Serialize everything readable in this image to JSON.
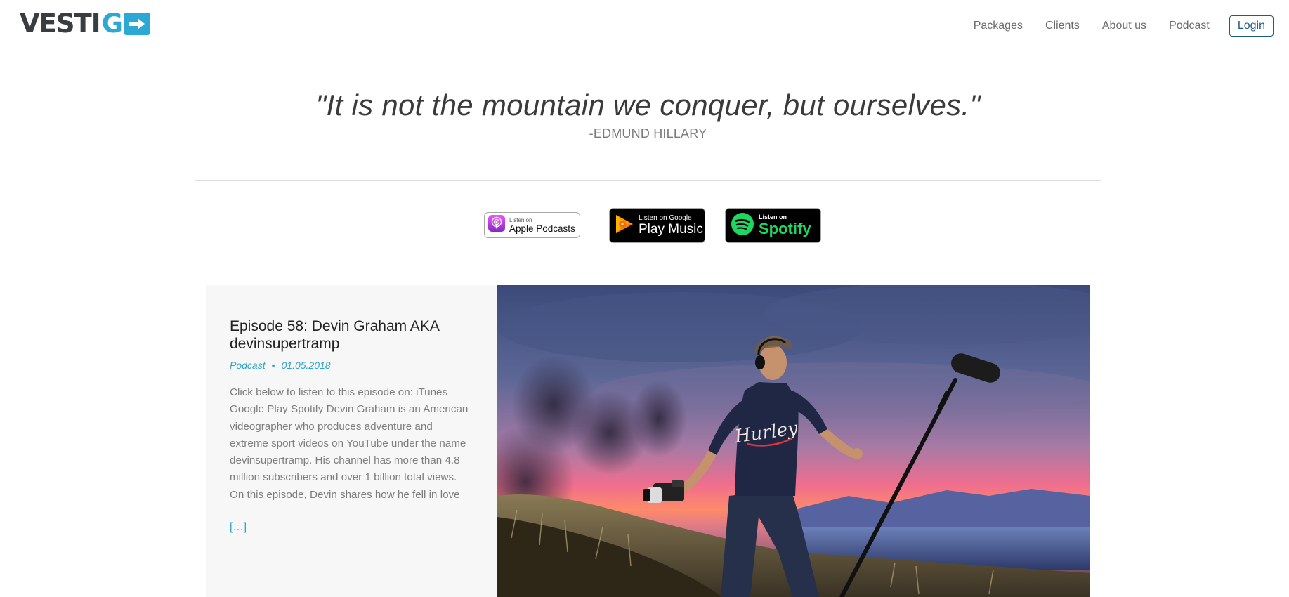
{
  "brand": {
    "logo_left": "VESTI",
    "logo_right": "G",
    "accent": "#2ba9d4",
    "logo_icon": "arrow-right-icon"
  },
  "nav": {
    "items": [
      {
        "label": "Packages"
      },
      {
        "label": "Clients"
      },
      {
        "label": "About us"
      },
      {
        "label": "Podcast"
      }
    ],
    "login_label": "Login"
  },
  "quote": {
    "text": "\"It is not the mountain we conquer, but ourselves.\"",
    "author": "-EDMUND HILLARY"
  },
  "badges": {
    "apple": {
      "small": "Listen on",
      "big": "Apple Podcasts",
      "icon": "podcast-icon"
    },
    "google": {
      "small": "Listen on Google",
      "big": "Play Music",
      "icon": "play-music-icon"
    },
    "spotify": {
      "small": "Listen on",
      "big": "Spotify",
      "icon": "spotify-icon"
    }
  },
  "episode": {
    "title": "Episode 58: Devin Graham AKA devinsupertramp",
    "category": "Podcast",
    "separator": "•",
    "date": "01.05.2018",
    "excerpt": "Click below to listen to this episode on: iTunes Google Play Spotify Devin Graham is an American videographer who produces adventure and extreme sport videos on YouTube under the name devinsupertramp. His channel has more than 4.8 million subscribers and over 1 billion total views. On this episode, Devin shares how he fell in love",
    "more_label": "[…]",
    "shirt_text": "Hurley"
  }
}
